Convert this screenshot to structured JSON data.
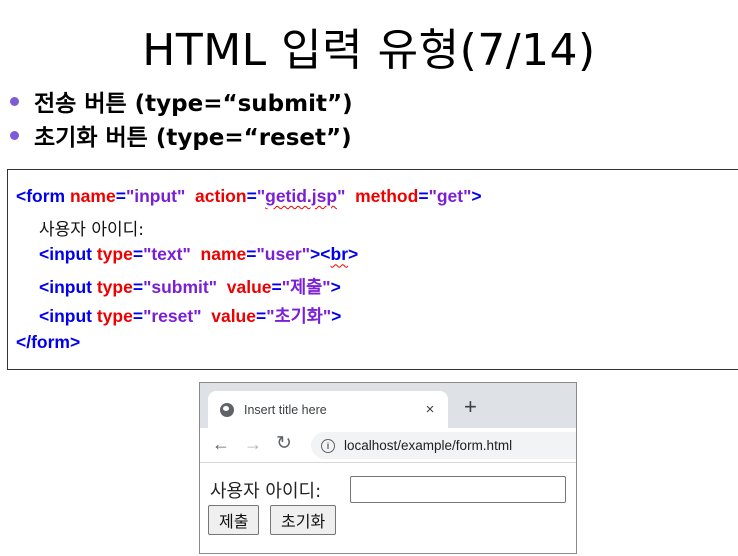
{
  "slide": {
    "title": "HTML 입력 유형(7/14)",
    "bullets": [
      "전송 버튼 (type=“submit”)",
      "초기화 버튼 (type=“reset”)"
    ]
  },
  "code": {
    "line1": {
      "open": "<form ",
      "name_attr": "name",
      "eq1": "=",
      "name_val": "\"input\"",
      "action_attr": "action",
      "eq2": "=",
      "q1": "\"",
      "action_val": "getid.jsp",
      "q2": "\"",
      "method_attr": "method",
      "eq3": "=",
      "method_val": "\"get\"",
      "close": ">"
    },
    "line2": "사용자 아이디:",
    "line3": {
      "open": "<input ",
      "type_attr": "type",
      "eq1": "=",
      "type_val": "\"text\"",
      "name_attr": "name",
      "eq2": "=",
      "name_val": "\"user\"",
      "close": ">",
      "q1": "<",
      "br": "br",
      "q2": ">"
    },
    "line4": {
      "open": "<input ",
      "type_attr": "type",
      "eq1": "=",
      "type_val": "\"submit\"",
      "value_attr": "value",
      "eq2": "=",
      "q1": "\"",
      "value_val": "제출",
      "q2": "\"",
      "close": ">"
    },
    "line5": {
      "open": "<input ",
      "type_attr": "type",
      "eq1": "=",
      "type_val": "\"reset\"",
      "value_attr": "value",
      "eq2": "=",
      "q1": "\"",
      "value_val": "초기화",
      "q2": "\"",
      "close": ">"
    },
    "line6": "</form>"
  },
  "browser": {
    "tab_title": "Insert title here",
    "tab_close": "×",
    "new_tab": "+",
    "back": "←",
    "forward": "→",
    "reload": "↻",
    "info": "i",
    "url": "localhost/example/form.html",
    "form": {
      "label": "사용자 아이디:",
      "input_value": "",
      "submit_label": "제출",
      "reset_label": "초기화"
    }
  }
}
